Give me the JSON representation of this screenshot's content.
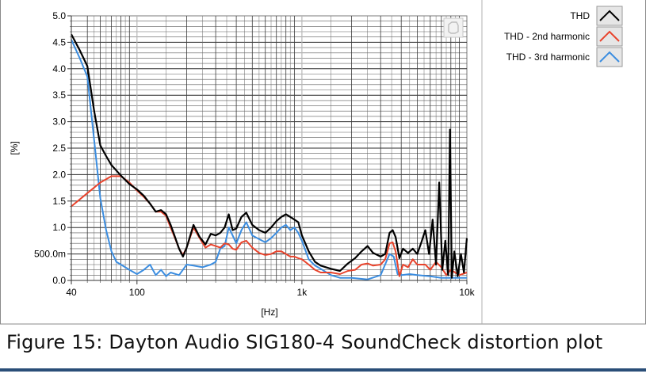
{
  "chart_data": {
    "type": "line",
    "xscale": "log",
    "xlim": [
      40,
      10000
    ],
    "ylim": [
      0,
      5
    ],
    "xlabel": "[Hz]",
    "ylabel": "[%]",
    "x_ticks": [
      {
        "value": 40,
        "label": "40"
      },
      {
        "value": 100,
        "label": "100"
      },
      {
        "value": 1000,
        "label": "1k"
      },
      {
        "value": 10000,
        "label": "10k"
      }
    ],
    "y_ticks": [
      {
        "value": 0,
        "label": "0.0"
      },
      {
        "value": 0.5,
        "label": "500.0m"
      },
      {
        "value": 1,
        "label": "1.0"
      },
      {
        "value": 1.5,
        "label": "1.5"
      },
      {
        "value": 2,
        "label": "2.0"
      },
      {
        "value": 2.5,
        "label": "2.5"
      },
      {
        "value": 3,
        "label": "3.0"
      },
      {
        "value": 3.5,
        "label": "3.5"
      },
      {
        "value": 4,
        "label": "4.0"
      },
      {
        "value": 4.5,
        "label": "4.5"
      },
      {
        "value": 5,
        "label": "5.0"
      }
    ],
    "grid": true,
    "legend_position": "right",
    "series": [
      {
        "name": "THD",
        "color": "#000000",
        "points": [
          [
            40,
            4.65
          ],
          [
            45,
            4.35
          ],
          [
            50,
            4.05
          ],
          [
            55,
            3.2
          ],
          [
            60,
            2.55
          ],
          [
            65,
            2.35
          ],
          [
            70,
            2.18
          ],
          [
            80,
            1.98
          ],
          [
            90,
            1.82
          ],
          [
            100,
            1.72
          ],
          [
            110,
            1.6
          ],
          [
            120,
            1.45
          ],
          [
            130,
            1.3
          ],
          [
            140,
            1.33
          ],
          [
            150,
            1.25
          ],
          [
            160,
            1.05
          ],
          [
            170,
            0.82
          ],
          [
            180,
            0.6
          ],
          [
            190,
            0.45
          ],
          [
            200,
            0.62
          ],
          [
            220,
            1.05
          ],
          [
            240,
            0.82
          ],
          [
            260,
            0.68
          ],
          [
            280,
            0.88
          ],
          [
            300,
            0.85
          ],
          [
            320,
            0.9
          ],
          [
            340,
            1.0
          ],
          [
            360,
            1.25
          ],
          [
            380,
            0.95
          ],
          [
            400,
            0.98
          ],
          [
            430,
            1.2
          ],
          [
            460,
            1.28
          ],
          [
            500,
            1.05
          ],
          [
            550,
            0.95
          ],
          [
            600,
            0.9
          ],
          [
            650,
            1.0
          ],
          [
            700,
            1.12
          ],
          [
            750,
            1.2
          ],
          [
            800,
            1.25
          ],
          [
            850,
            1.2
          ],
          [
            900,
            1.15
          ],
          [
            950,
            1.1
          ],
          [
            1000,
            0.85
          ],
          [
            1100,
            0.55
          ],
          [
            1200,
            0.35
          ],
          [
            1300,
            0.28
          ],
          [
            1500,
            0.22
          ],
          [
            1700,
            0.18
          ],
          [
            1900,
            0.32
          ],
          [
            2100,
            0.42
          ],
          [
            2300,
            0.55
          ],
          [
            2500,
            0.65
          ],
          [
            2700,
            0.52
          ],
          [
            3000,
            0.45
          ],
          [
            3200,
            0.5
          ],
          [
            3400,
            0.9
          ],
          [
            3550,
            0.95
          ],
          [
            3700,
            0.82
          ],
          [
            3900,
            0.42
          ],
          [
            4100,
            0.6
          ],
          [
            4400,
            0.52
          ],
          [
            4700,
            0.6
          ],
          [
            5000,
            0.5
          ],
          [
            5300,
            0.72
          ],
          [
            5600,
            0.95
          ],
          [
            5900,
            0.5
          ],
          [
            6200,
            1.15
          ],
          [
            6500,
            0.3
          ],
          [
            6800,
            1.85
          ],
          [
            7100,
            0.2
          ],
          [
            7400,
            0.75
          ],
          [
            7700,
            0.1
          ],
          [
            7900,
            2.85
          ],
          [
            8100,
            0.05
          ],
          [
            8400,
            0.55
          ],
          [
            8800,
            0.08
          ],
          [
            9200,
            0.5
          ],
          [
            9600,
            0.15
          ],
          [
            10000,
            0.8
          ]
        ]
      },
      {
        "name": "THD - 2nd harmonic",
        "color": "#e8432c",
        "points": [
          [
            40,
            1.4
          ],
          [
            50,
            1.65
          ],
          [
            60,
            1.85
          ],
          [
            70,
            1.97
          ],
          [
            80,
            1.97
          ],
          [
            90,
            1.85
          ],
          [
            100,
            1.7
          ],
          [
            110,
            1.58
          ],
          [
            120,
            1.45
          ],
          [
            130,
            1.3
          ],
          [
            140,
            1.3
          ],
          [
            150,
            1.22
          ],
          [
            160,
            1.0
          ],
          [
            170,
            0.8
          ],
          [
            180,
            0.6
          ],
          [
            190,
            0.48
          ],
          [
            200,
            0.62
          ],
          [
            220,
            1.0
          ],
          [
            240,
            0.8
          ],
          [
            260,
            0.62
          ],
          [
            280,
            0.68
          ],
          [
            300,
            0.65
          ],
          [
            320,
            0.62
          ],
          [
            340,
            0.7
          ],
          [
            360,
            0.68
          ],
          [
            380,
            0.6
          ],
          [
            400,
            0.58
          ],
          [
            430,
            0.72
          ],
          [
            460,
            0.75
          ],
          [
            500,
            0.62
          ],
          [
            550,
            0.52
          ],
          [
            600,
            0.48
          ],
          [
            650,
            0.5
          ],
          [
            700,
            0.55
          ],
          [
            750,
            0.55
          ],
          [
            800,
            0.5
          ],
          [
            850,
            0.45
          ],
          [
            900,
            0.45
          ],
          [
            950,
            0.42
          ],
          [
            1000,
            0.4
          ],
          [
            1100,
            0.3
          ],
          [
            1200,
            0.2
          ],
          [
            1300,
            0.15
          ],
          [
            1500,
            0.15
          ],
          [
            1700,
            0.12
          ],
          [
            1900,
            0.18
          ],
          [
            2100,
            0.2
          ],
          [
            2300,
            0.3
          ],
          [
            2500,
            0.32
          ],
          [
            2700,
            0.28
          ],
          [
            3000,
            0.3
          ],
          [
            3200,
            0.4
          ],
          [
            3400,
            0.7
          ],
          [
            3550,
            0.72
          ],
          [
            3700,
            0.55
          ],
          [
            3900,
            0.08
          ],
          [
            4100,
            0.3
          ],
          [
            4400,
            0.25
          ],
          [
            4700,
            0.4
          ],
          [
            5000,
            0.3
          ],
          [
            5300,
            0.3
          ],
          [
            5600,
            0.3
          ],
          [
            6000,
            0.2
          ],
          [
            6500,
            0.35
          ],
          [
            7000,
            0.25
          ],
          [
            7500,
            0.1
          ],
          [
            8000,
            0.2
          ],
          [
            9000,
            0.1
          ],
          [
            10000,
            0.15
          ]
        ]
      },
      {
        "name": "THD - 3rd harmonic",
        "color": "#3b8de0",
        "points": [
          [
            40,
            4.55
          ],
          [
            45,
            4.2
          ],
          [
            50,
            3.85
          ],
          [
            55,
            2.65
          ],
          [
            60,
            1.55
          ],
          [
            65,
            0.95
          ],
          [
            70,
            0.55
          ],
          [
            75,
            0.35
          ],
          [
            80,
            0.3
          ],
          [
            90,
            0.2
          ],
          [
            100,
            0.12
          ],
          [
            110,
            0.2
          ],
          [
            120,
            0.3
          ],
          [
            130,
            0.1
          ],
          [
            140,
            0.2
          ],
          [
            150,
            0.08
          ],
          [
            160,
            0.15
          ],
          [
            180,
            0.1
          ],
          [
            200,
            0.3
          ],
          [
            220,
            0.28
          ],
          [
            250,
            0.25
          ],
          [
            280,
            0.3
          ],
          [
            300,
            0.35
          ],
          [
            320,
            0.6
          ],
          [
            340,
            0.65
          ],
          [
            360,
            1.0
          ],
          [
            380,
            0.85
          ],
          [
            400,
            0.7
          ],
          [
            430,
            0.95
          ],
          [
            460,
            1.1
          ],
          [
            500,
            0.85
          ],
          [
            550,
            0.78
          ],
          [
            600,
            0.72
          ],
          [
            650,
            0.8
          ],
          [
            700,
            0.9
          ],
          [
            750,
            1.0
          ],
          [
            800,
            1.05
          ],
          [
            850,
            0.95
          ],
          [
            900,
            1.0
          ],
          [
            950,
            0.9
          ],
          [
            1000,
            0.75
          ],
          [
            1100,
            0.4
          ],
          [
            1200,
            0.28
          ],
          [
            1300,
            0.22
          ],
          [
            1500,
            0.1
          ],
          [
            1700,
            0.05
          ],
          [
            2000,
            0.05
          ],
          [
            2500,
            0.02
          ],
          [
            3000,
            0.1
          ],
          [
            3400,
            0.5
          ],
          [
            3600,
            0.45
          ],
          [
            3800,
            0.12
          ],
          [
            4000,
            0.1
          ],
          [
            4500,
            0.12
          ],
          [
            5000,
            0.1
          ],
          [
            6000,
            0.08
          ],
          [
            7000,
            0.05
          ],
          [
            8000,
            0.05
          ],
          [
            10000,
            0.05
          ]
        ]
      }
    ]
  },
  "caption": "Figure 15: Dayton Audio SIG180-4 SoundCheck distortion plot"
}
